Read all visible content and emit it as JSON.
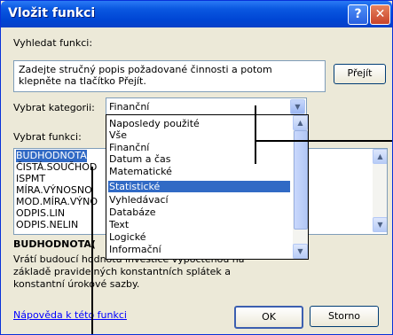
{
  "window": {
    "title": "Vložit funkci"
  },
  "search": {
    "label": "Vyhledat funkci:",
    "placeholder": "Zadejte stručný popis požadované činnosti a potom klepněte na tlačítko Přejít.",
    "go_button": "Přejít"
  },
  "category": {
    "label": "Vybrat kategorii:",
    "value": "Finanční"
  },
  "category_options": [
    "Naposledy použité",
    "Vše",
    "Finanční",
    "Datum a čas",
    "Matematické",
    "Statistické",
    "Vyhledávací",
    "Databáze",
    "Text",
    "Logické",
    "Informační"
  ],
  "category_selected": "Statistické",
  "functions": {
    "label": "Vybrat funkci:",
    "items": [
      "BUDHODNOTA",
      "ČISTÁ.SOUČHOD",
      "ISPMT",
      "MÍRA.VÝNOSNO",
      "MOD.MÍRA.VÝNO",
      "ODPIS.LIN",
      "ODPIS.NELIN"
    ],
    "selected": "BUDHODNOTA"
  },
  "detail": {
    "name": "BUDHODNOTA(",
    "description": "Vrátí budoucí hodnotu investice vypočtenou na základě pravidelných konstantních splátek a konstantní úrokové sazby."
  },
  "help_link": "Nápověda k této funkci",
  "buttons": {
    "ok": "OK",
    "cancel": "Storno"
  },
  "icons": {
    "help": "?",
    "close": "✕",
    "dropdown": "▼",
    "scroll_up": "▲",
    "scroll_down": "▼"
  }
}
